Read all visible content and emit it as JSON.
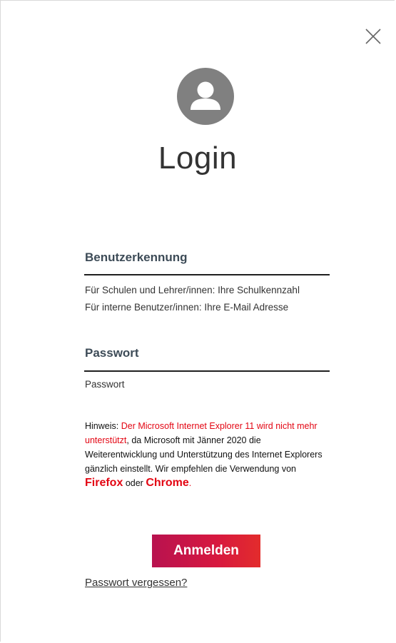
{
  "dialog": {
    "title": "Login",
    "close_icon": "close-icon",
    "avatar_icon": "user-avatar-icon"
  },
  "username": {
    "label": "Benutzerkennung",
    "value": "",
    "hint_line1": "Für Schulen und Lehrer/innen: Ihre Schulkennzahl",
    "hint_line2": "Für interne Benutzer/innen: Ihre E-Mail Adresse"
  },
  "password": {
    "label": "Passwort",
    "value": "",
    "hint": "Passwort"
  },
  "notice": {
    "prefix": "Hinweis: ",
    "highlight": "Der Microsoft Internet Explorer 11 wird nicht mehr unterstützt",
    "body": ", da Microsoft mit Jänner 2020 die Weiterentwicklung und Unterstützung des Internet Explorers gänzlich einstellt. Wir empfehlen die Verwendung von ",
    "browser1": "Firefox",
    "connector": " oder ",
    "browser2": "Chrome",
    "suffix": "."
  },
  "actions": {
    "submit_label": "Anmelden",
    "forgot_label": "Passwort vergessen?"
  },
  "colors": {
    "accent": "#e30613",
    "button_gradient_start": "#b8124f",
    "button_gradient_end": "#e32c2c",
    "avatar_bg": "#808080"
  }
}
